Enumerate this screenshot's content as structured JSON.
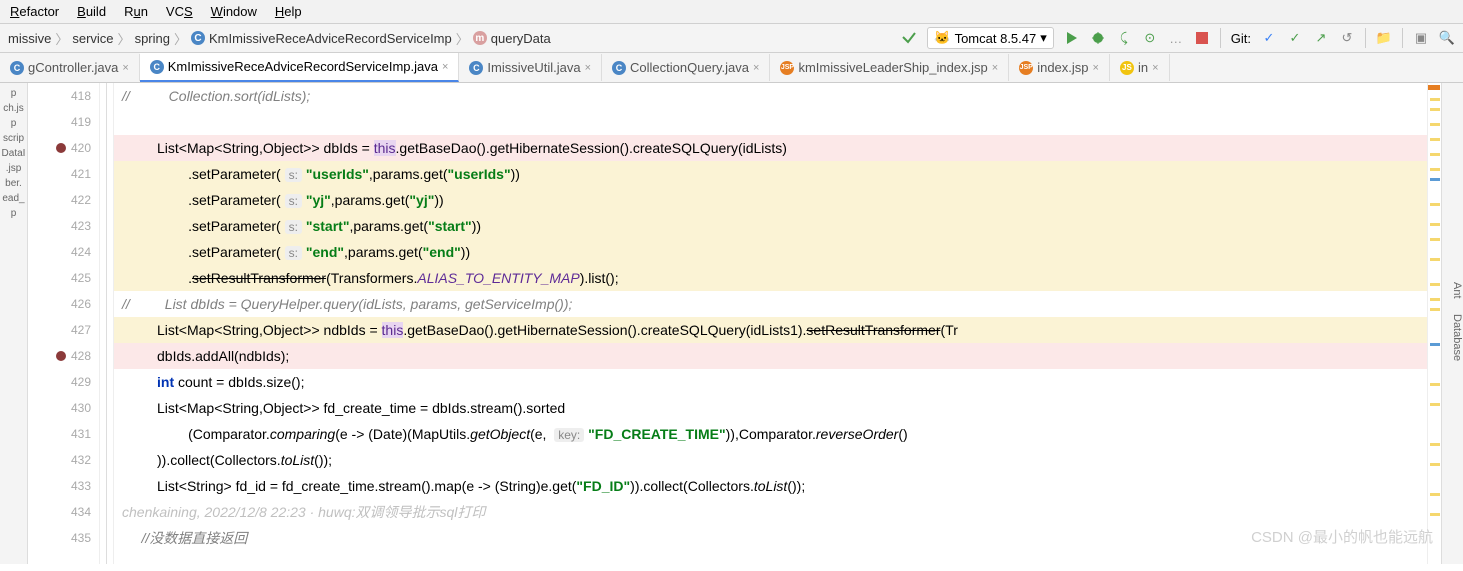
{
  "menu": [
    "Refactor",
    "Build",
    "Run",
    "VCS",
    "Window",
    "Help"
  ],
  "breadcrumb": {
    "items": [
      "missive",
      "service",
      "spring"
    ],
    "class": "KmImissiveReceAdviceRecordServiceImp",
    "method": "queryData"
  },
  "runConfig": "Tomcat 8.5.47",
  "gitLabel": "Git:",
  "tabs": [
    {
      "name": "gController.java",
      "type": "java",
      "active": false
    },
    {
      "name": "KmImissiveReceAdviceRecordServiceImp.java",
      "type": "java",
      "active": true
    },
    {
      "name": "ImissiveUtil.java",
      "type": "java",
      "active": false
    },
    {
      "name": "CollectionQuery.java",
      "type": "java",
      "active": false
    },
    {
      "name": "kmImissiveLeaderShip_index.jsp",
      "type": "jsp",
      "active": false
    },
    {
      "name": "index.jsp",
      "type": "jsp",
      "active": false
    },
    {
      "name": "in",
      "type": "js",
      "active": false
    }
  ],
  "leftFragments": [
    "p",
    "ch.js",
    "p",
    "scrip",
    "DataI",
    ".jsp",
    "ber.",
    "ead_",
    "p"
  ],
  "lines": [
    {
      "num": 418,
      "bp": false,
      "cls": "",
      "html": "//          Collection.sort(idLists);",
      "type": "comment"
    },
    {
      "num": 419,
      "bp": false,
      "cls": "",
      "html": "",
      "type": "blank"
    },
    {
      "num": 420,
      "bp": true,
      "cls": "hl-pink",
      "type": "code420"
    },
    {
      "num": 421,
      "bp": false,
      "cls": "hl-yellow",
      "type": "code421"
    },
    {
      "num": 422,
      "bp": false,
      "cls": "hl-yellow",
      "type": "code422"
    },
    {
      "num": 423,
      "bp": false,
      "cls": "hl-yellow",
      "type": "code423"
    },
    {
      "num": 424,
      "bp": false,
      "cls": "hl-yellow",
      "type": "code424"
    },
    {
      "num": 425,
      "bp": false,
      "cls": "hl-yellow",
      "type": "code425"
    },
    {
      "num": 426,
      "bp": false,
      "cls": "",
      "html": "//         List dbIds = QueryHelper.query(idLists, params, getServiceImp());",
      "type": "comment"
    },
    {
      "num": 427,
      "bp": false,
      "cls": "hl-yellow",
      "type": "code427"
    },
    {
      "num": 428,
      "bp": true,
      "cls": "hl-pink",
      "type": "code428"
    },
    {
      "num": 429,
      "bp": false,
      "cls": "",
      "type": "code429"
    },
    {
      "num": 430,
      "bp": false,
      "cls": "",
      "type": "code430"
    },
    {
      "num": 431,
      "bp": false,
      "cls": "",
      "type": "code431"
    },
    {
      "num": 432,
      "bp": false,
      "cls": "",
      "type": "code432"
    },
    {
      "num": 433,
      "bp": false,
      "cls": "",
      "type": "code433"
    },
    {
      "num": 434,
      "bp": false,
      "cls": "",
      "type": "author"
    },
    {
      "num": 435,
      "bp": false,
      "cls": "",
      "html": "     //没数据直接返回",
      "type": "comment2"
    }
  ],
  "authorLine": "chenkaining, 2022/12/8 22:23 · huwq:双调领导批示sql打印",
  "rightLabels": [
    "Ant",
    "Database"
  ],
  "watermark": "CSDN @最小的帆也能远航"
}
